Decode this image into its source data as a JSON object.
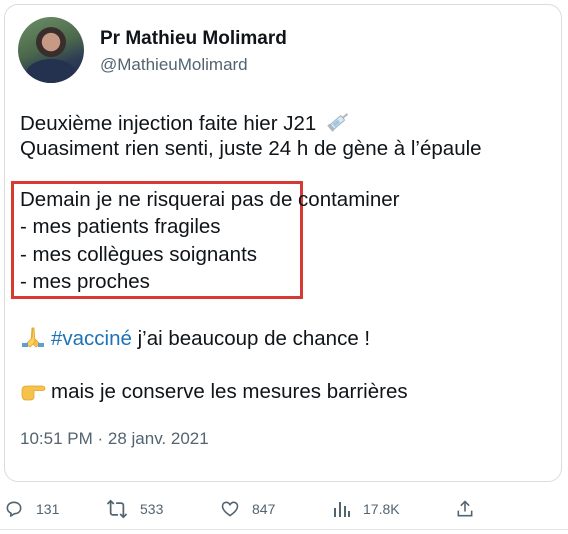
{
  "tweet": {
    "author_name": "Pr Mathieu Molimard",
    "author_handle": "@MathieuMolimard",
    "lines": {
      "l1": "Deuxième injection faite hier J21",
      "l2": "Quasiment rien senti, juste 24 h de gène à l’épaule",
      "b1": "Demain je ne risquerai pas de contaminer",
      "b2": "- mes patients fragiles",
      "b3": "- mes collègues soignants",
      "b4": "- mes proches",
      "hashtag": "#vacciné",
      "after_hashtag": " j’ai beaucoup de chance !",
      "last": "mais je conserve les mesures barrières"
    },
    "timestamp": "10:51 PM · 28 janv. 2021"
  },
  "actions": {
    "replies": "131",
    "retweets": "533",
    "likes": "847",
    "views": "17.8K"
  },
  "colors": {
    "highlight_border": "#d63a33",
    "hashtag": "#1d73b8",
    "secondary_text": "#536471"
  },
  "icons": [
    "syringe-icon",
    "praying-hands-icon",
    "pointing-hand-icon",
    "reply-icon",
    "retweet-icon",
    "like-icon",
    "views-icon",
    "share-icon"
  ]
}
